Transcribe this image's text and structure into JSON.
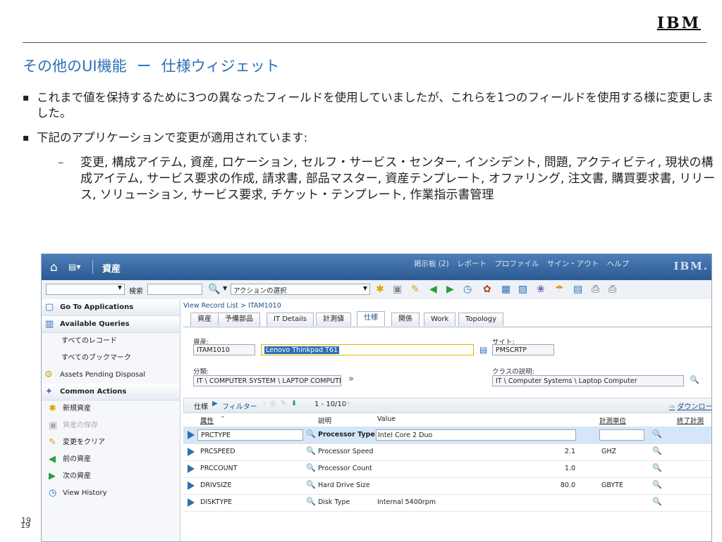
{
  "slide": {
    "logo": "IBM",
    "title_a": "その他のUI機能",
    "title_dash": "ー",
    "title_b": "仕様ウィジェット",
    "bullet1": "これまで値を保持するために3つの異なったフィールドを使用していましたが、これらを1つのフィールドを使用する様に変更しました。",
    "bullet2": "下記のアプリケーションで変更が適用されています:",
    "sub": "変更, 構成アイテム, 資産, ロケーション, セルフ・サービス・センター, インシデント, 問題, アクティビティ, 現状の構成アイテム, サービス要求の作成, 請求書, 部品マスター, 資産テンプレート, オファリング, 注文書, 購買要求書, リリース, ソリューション, サービス要求, チケット・テンプレート, 作業指示書管理",
    "page": "19"
  },
  "app": {
    "title": "資産",
    "header_links": [
      "掲示板 (2)",
      "レポート",
      "プロファイル",
      "サイン・アウト",
      "ヘルプ"
    ],
    "logo": "IBM.",
    "search_label": "検索",
    "action_select": "アクションの選択",
    "sidebar": {
      "go_to": "Go To Applications",
      "queries_head": "Available Queries",
      "query_all_records": "すべてのレコード",
      "query_all_bookmarks": "すべてのブックマーク",
      "query_pending": "Assets Pending Disposal",
      "actions_head": "Common Actions",
      "new_asset": "新規資産",
      "save_asset": "資産の保存",
      "clear": "変更をクリア",
      "prev": "前の資産",
      "next": "次の資産",
      "history": "View History"
    },
    "breadcrumb": "View Record List > ITAM1010",
    "tabs": [
      "資産",
      "予備部品",
      "IT Details",
      "計測値",
      "仕様",
      "関係",
      "Work",
      "Topology"
    ],
    "form": {
      "asset_label": "資産:",
      "asset_num": "ITAM1010",
      "asset_desc": "Lenovo Thinkpad T61",
      "site_label": "サイト:",
      "site": "PMSCRTP",
      "class_label": "分類:",
      "class": "IT \\ COMPUTER SYSTEM \\ LAPTOP COMPUTER",
      "class_desc_label": "クラスの説明:",
      "class_desc": "IT \\ Computer Systems \\ Laptop Computer"
    },
    "table": {
      "title": "仕様",
      "filter": "フィルター",
      "count": "1 - 10/10",
      "download": "ダウンロード",
      "headers": [
        "属性",
        "説明",
        "Value",
        "計測単位",
        "終了計測"
      ],
      "rows": [
        {
          "attr": "PRCTYPE",
          "desc": "Processor Type",
          "val": "Intel Core 2 Duo",
          "num": "",
          "unit": ""
        },
        {
          "attr": "PRCSPEED",
          "desc": "Processor Speed",
          "val": "",
          "num": "2.1",
          "unit": "GHZ"
        },
        {
          "attr": "PRCCOUNT",
          "desc": "Processor Count",
          "val": "",
          "num": "1.0",
          "unit": ""
        },
        {
          "attr": "DRIVSIZE",
          "desc": "Hard Drive Size",
          "val": "",
          "num": "80.0",
          "unit": "GBYTE"
        },
        {
          "attr": "DISKTYPE",
          "desc": "Disk Type",
          "val": "Internal 5400rpm",
          "num": "",
          "unit": ""
        }
      ]
    }
  }
}
